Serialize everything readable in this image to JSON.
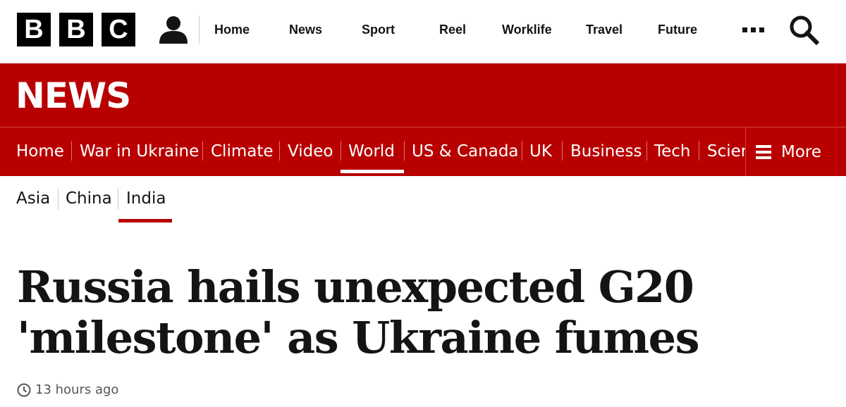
{
  "brand": {
    "logo_letters": [
      "B",
      "B",
      "C"
    ],
    "news_title": "NEWS"
  },
  "top_nav": {
    "items": [
      "Home",
      "News",
      "Sport",
      "Reel",
      "Worklife",
      "Travel",
      "Future"
    ],
    "more_icon": "ellipsis-icon",
    "account_icon": "account-icon",
    "search_icon": "search-icon"
  },
  "section_nav": {
    "items": [
      "Home",
      "War in Ukraine",
      "Climate",
      "Video",
      "World",
      "US & Canada",
      "UK",
      "Business",
      "Tech",
      "Science"
    ],
    "active": "World",
    "more_label": "More"
  },
  "sub_nav": {
    "items": [
      "Asia",
      "China",
      "India"
    ],
    "active": "India"
  },
  "article": {
    "headline_line1": "Russia hails unexpected G20",
    "headline_line2": "'milestone' as Ukraine fumes",
    "timestamp": "13 hours ago"
  },
  "colors": {
    "brand_red": "#b80000",
    "text_dark": "#141414",
    "text_muted": "#545658"
  }
}
